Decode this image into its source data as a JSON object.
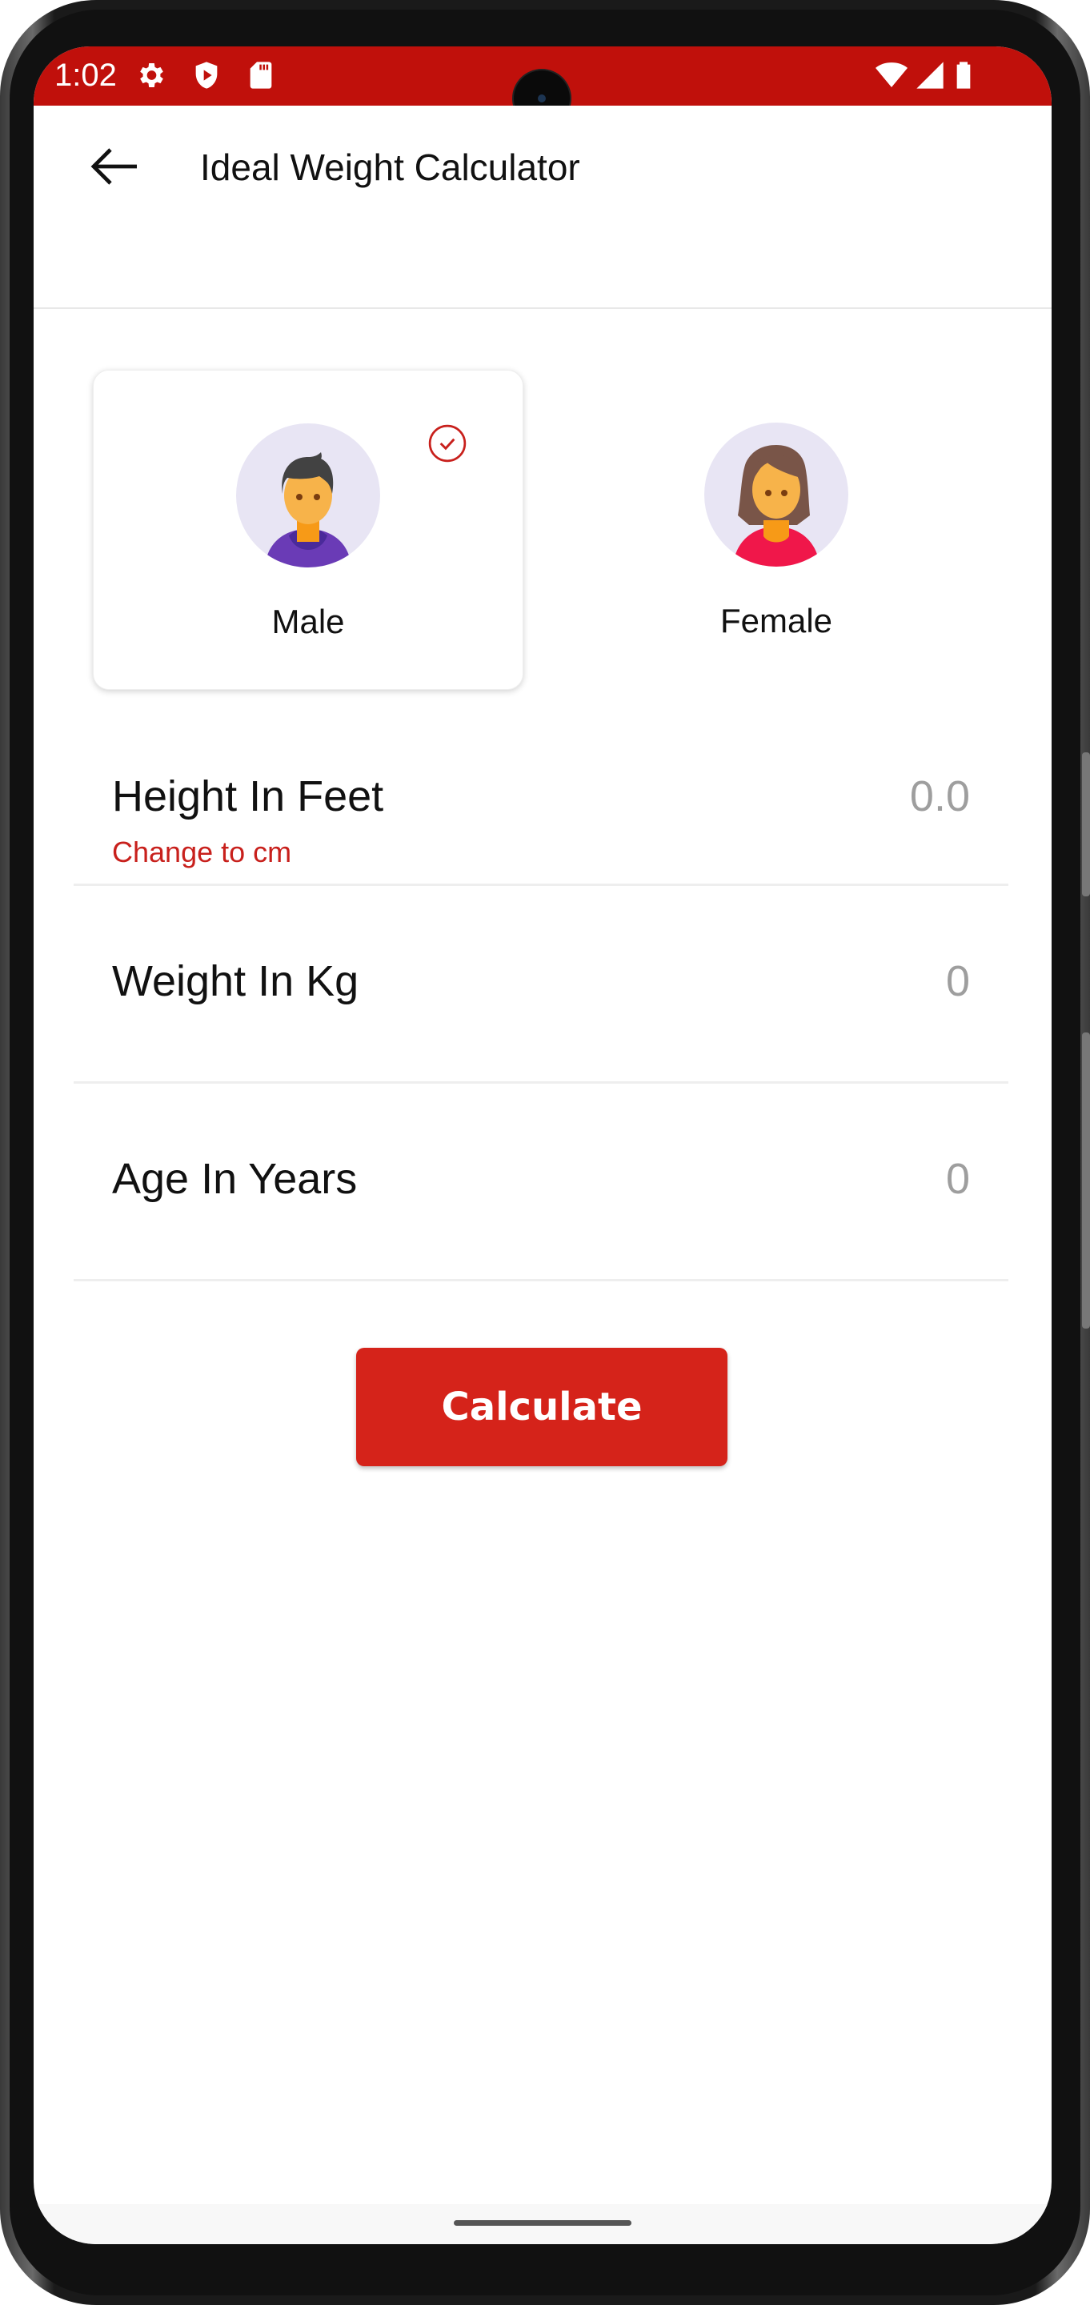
{
  "status_bar": {
    "time": "1:02",
    "left_icons": [
      "settings-icon",
      "play-protect-icon",
      "sd-card-icon"
    ],
    "right_icons": [
      "wifi-icon",
      "signal-icon",
      "battery-icon"
    ],
    "color": "#c0100b"
  },
  "app_bar": {
    "back_icon": "arrow-left-icon",
    "title": "Ideal Weight Calculator"
  },
  "gender": {
    "selected": "male",
    "options": [
      {
        "id": "male",
        "label": "Male",
        "selected": true,
        "icon": "male-avatar-icon"
      },
      {
        "id": "female",
        "label": "Female",
        "selected": false,
        "icon": "female-avatar-icon"
      }
    ],
    "check_icon": "check-circle-icon"
  },
  "fields": {
    "height": {
      "label": "Height In Feet",
      "value": "0.0",
      "unit_toggle": "Change to cm"
    },
    "weight": {
      "label": "Weight In Kg",
      "value": "0"
    },
    "age": {
      "label": "Age In Years",
      "value": "0"
    }
  },
  "actions": {
    "calculate_label": "Calculate",
    "accent_color": "#d5231a"
  }
}
